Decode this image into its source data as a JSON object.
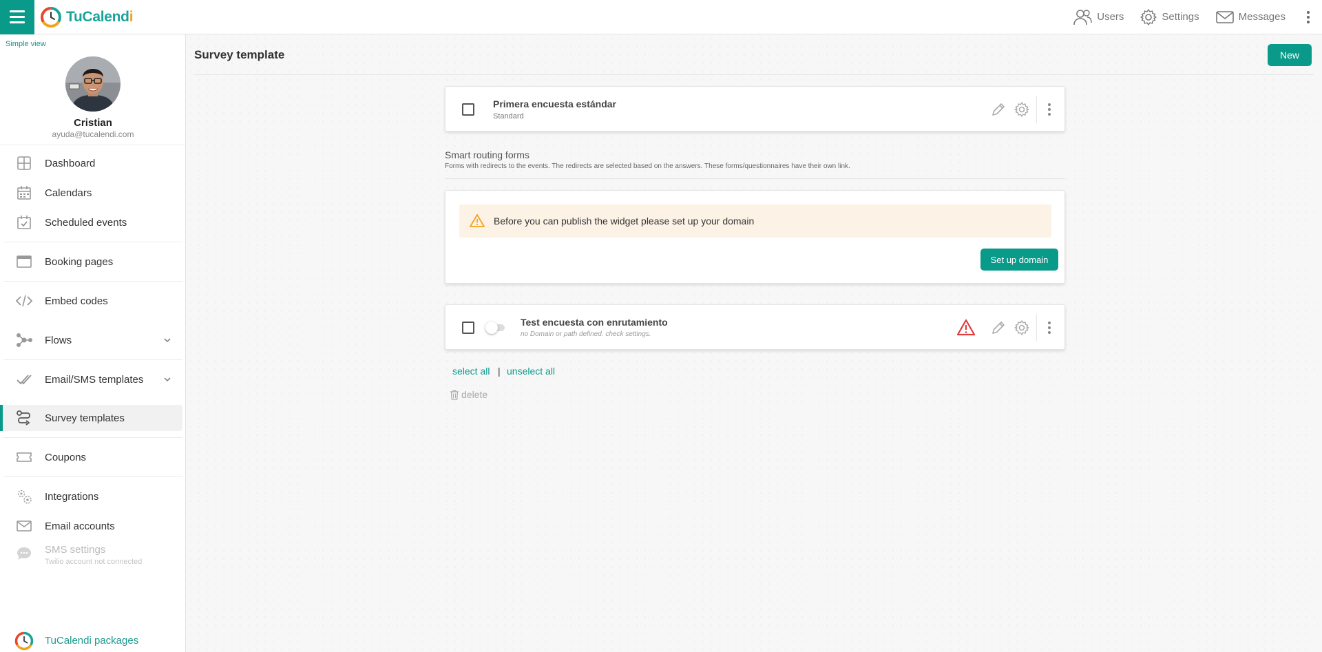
{
  "brand": {
    "name_part1": "TuCalend",
    "name_part2": "i"
  },
  "topnav": {
    "users": "Users",
    "settings": "Settings",
    "messages": "Messages"
  },
  "sidebar": {
    "simple_view": "Simple view",
    "user": {
      "name": "Cristian",
      "email": "ayuda@tucalendi.com"
    },
    "items": [
      {
        "label": "Dashboard"
      },
      {
        "label": "Calendars"
      },
      {
        "label": "Scheduled events"
      },
      {
        "label": "Booking pages"
      },
      {
        "label": "Embed codes"
      },
      {
        "label": "Flows"
      },
      {
        "label": "Email/SMS templates"
      },
      {
        "label": "Survey templates"
      },
      {
        "label": "Coupons"
      },
      {
        "label": "Integrations"
      },
      {
        "label": "Email accounts"
      }
    ],
    "sms": {
      "label": "SMS settings",
      "sub": "Twilio account not connected"
    },
    "packages": "TuCalendi packages"
  },
  "main": {
    "title": "Survey template",
    "new_button": "New",
    "standard_survey": {
      "title": "Primera encuesta estándar",
      "type": "Standard"
    },
    "routing": {
      "title": "Smart routing forms",
      "description": "Forms with redirects to the events. The redirects are selected based on the answers. These forms/questionnaires have their own link."
    },
    "domain_alert": {
      "text": "Before you can publish the widget please set up your domain",
      "button": "Set up domain"
    },
    "routing_form": {
      "title": "Test encuesta con enrutamiento",
      "note": "no Domain or path defined. check settings."
    },
    "select_all": "select all",
    "separator": "|",
    "unselect_all": "unselect all",
    "delete": "delete"
  },
  "colors": {
    "accent": "#0a9a8a",
    "alert_bg": "#fdf2e6",
    "warning": "#f3a21a",
    "danger": "#e23b3b"
  }
}
